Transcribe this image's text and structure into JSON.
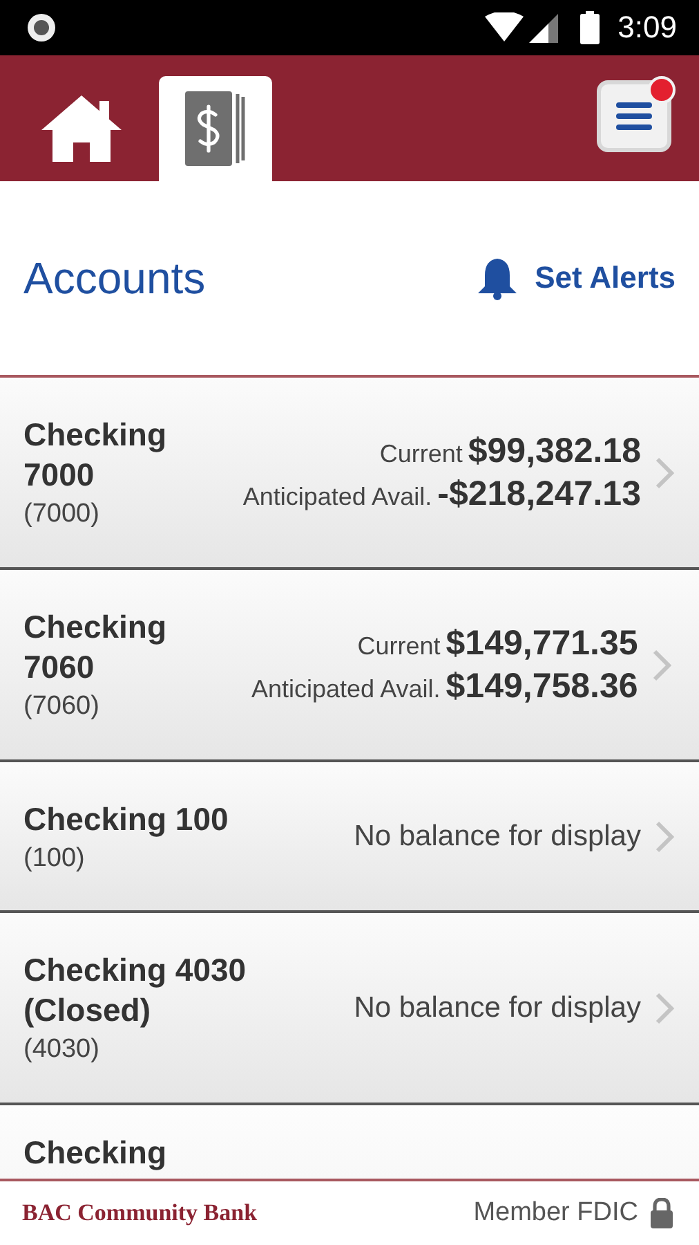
{
  "status_bar": {
    "time": "3:09"
  },
  "nav": {
    "tabs": [
      {
        "kind": "home",
        "selected": false
      },
      {
        "kind": "accounts",
        "selected": true
      }
    ],
    "menu": {
      "notification": true
    }
  },
  "page": {
    "title": "Accounts",
    "alerts_button": "Set Alerts"
  },
  "accounts": [
    {
      "kind": "balances",
      "name": "Checking 7000",
      "number": "(7000)",
      "balances": [
        {
          "label": "Current",
          "amount": "$99,382.18"
        },
        {
          "label": "Anticipated Avail.",
          "amount": "-$218,247.13"
        }
      ]
    },
    {
      "kind": "balances",
      "name": "Checking 7060",
      "number": "(7060)",
      "balances": [
        {
          "label": "Current",
          "amount": "$149,771.35"
        },
        {
          "label": "Anticipated Avail.",
          "amount": "$149,758.36"
        }
      ]
    },
    {
      "kind": "message",
      "name": "Checking 100",
      "number": "(100)",
      "message": "No balance for display"
    },
    {
      "kind": "message",
      "name": "Checking 4030 (Closed)",
      "number": "(4030)",
      "message": "No balance for display"
    },
    {
      "kind": "partial",
      "name": "Checking"
    }
  ],
  "footer": {
    "bank": "BAC Community Bank",
    "member": "Member FDIC"
  }
}
